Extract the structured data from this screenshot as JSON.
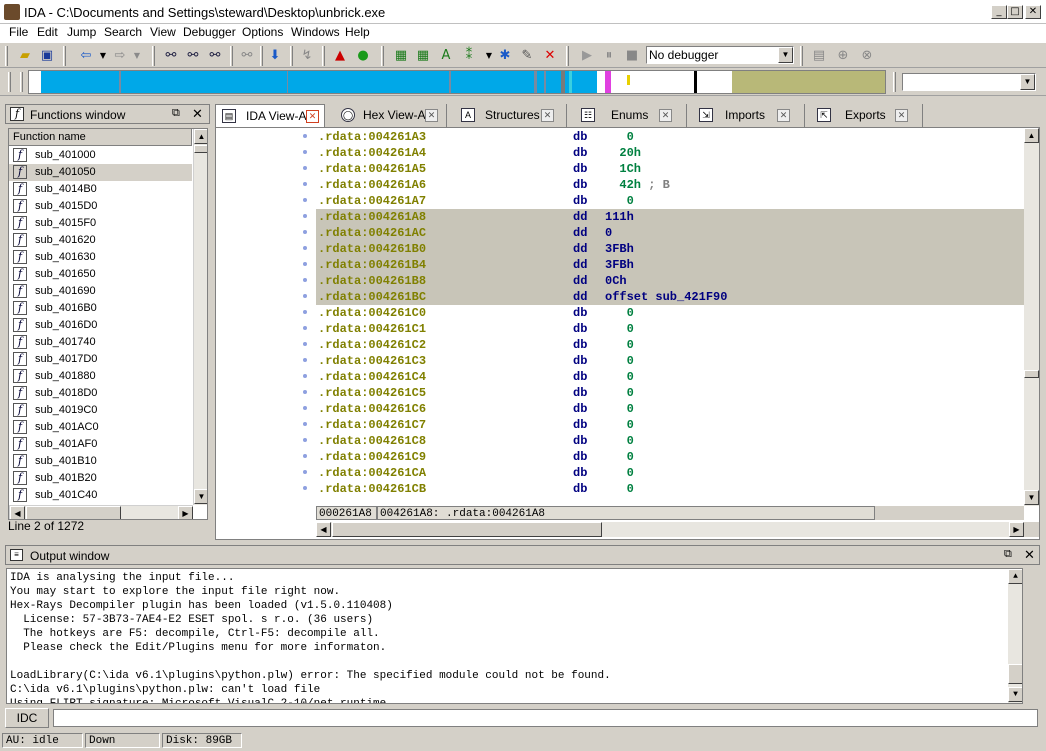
{
  "window": {
    "title": "IDA - C:\\Documents and Settings\\steward\\Desktop\\unbrick.exe"
  },
  "menu": [
    "File",
    "Edit",
    "Jump",
    "Search",
    "View",
    "Debugger",
    "Options",
    "Windows",
    "Help"
  ],
  "toolbar": {
    "debugger_select": "No debugger"
  },
  "functions_window": {
    "title": "Functions window",
    "column_header": "Function name",
    "items": [
      "sub_401000",
      "sub_401050",
      "sub_4014B0",
      "sub_4015D0",
      "sub_4015F0",
      "sub_401620",
      "sub_401630",
      "sub_401650",
      "sub_401690",
      "sub_4016B0",
      "sub_4016D0",
      "sub_401740",
      "sub_4017D0",
      "sub_401880",
      "sub_4018D0",
      "sub_4019C0",
      "sub_401AC0",
      "sub_401AF0",
      "sub_401B10",
      "sub_401B20",
      "sub_401C40"
    ],
    "status": "Line 2 of 1272"
  },
  "tabs": [
    "IDA View-A",
    "Hex View-A",
    "Structures",
    "Enums",
    "Imports",
    "Exports"
  ],
  "disasm": [
    {
      "addr": ".rdata:004261A3",
      "mn": "db",
      "op": "   0",
      "sel": false
    },
    {
      "addr": ".rdata:004261A4",
      "mn": "db",
      "op": "  20h",
      "sel": false
    },
    {
      "addr": ".rdata:004261A5",
      "mn": "db",
      "op": "  1Ch",
      "sel": false
    },
    {
      "addr": ".rdata:004261A6",
      "mn": "db",
      "op": "  42h",
      "cm": " ; B",
      "sel": false
    },
    {
      "addr": ".rdata:004261A7",
      "mn": "db",
      "op": "   0",
      "sel": false
    },
    {
      "addr": ".rdata:004261A8",
      "mn": "dd",
      "op": "111h",
      "sel": true
    },
    {
      "addr": ".rdata:004261AC",
      "mn": "dd",
      "op": "0",
      "sel": true
    },
    {
      "addr": ".rdata:004261B0",
      "mn": "dd",
      "op": "3FBh",
      "sel": true
    },
    {
      "addr": ".rdata:004261B4",
      "mn": "dd",
      "op": "3FBh",
      "sel": true
    },
    {
      "addr": ".rdata:004261B8",
      "mn": "dd",
      "op": "0Ch",
      "sel": true
    },
    {
      "addr": ".rdata:004261BC",
      "mn": "dd",
      "op": "offset sub_421F90",
      "sel": true
    },
    {
      "addr": ".rdata:004261C0",
      "mn": "db",
      "op": "   0",
      "sel": false
    },
    {
      "addr": ".rdata:004261C1",
      "mn": "db",
      "op": "   0",
      "sel": false
    },
    {
      "addr": ".rdata:004261C2",
      "mn": "db",
      "op": "   0",
      "sel": false
    },
    {
      "addr": ".rdata:004261C3",
      "mn": "db",
      "op": "   0",
      "sel": false
    },
    {
      "addr": ".rdata:004261C4",
      "mn": "db",
      "op": "   0",
      "sel": false
    },
    {
      "addr": ".rdata:004261C5",
      "mn": "db",
      "op": "   0",
      "sel": false
    },
    {
      "addr": ".rdata:004261C6",
      "mn": "db",
      "op": "   0",
      "sel": false
    },
    {
      "addr": ".rdata:004261C7",
      "mn": "db",
      "op": "   0",
      "sel": false
    },
    {
      "addr": ".rdata:004261C8",
      "mn": "db",
      "op": "   0",
      "sel": false
    },
    {
      "addr": ".rdata:004261C9",
      "mn": "db",
      "op": "   0",
      "sel": false
    },
    {
      "addr": ".rdata:004261CA",
      "mn": "db",
      "op": "   0",
      "sel": false
    },
    {
      "addr": ".rdata:004261CB",
      "mn": "db",
      "op": "   0",
      "sel": false
    }
  ],
  "view_status": {
    "offset": "000261A8",
    "location": "004261A8: .rdata:004261A8"
  },
  "output_window": {
    "title": "Output window",
    "lines": [
      "IDA is analysing the input file...",
      "You may start to explore the input file right now.",
      "Hex-Rays Decompiler plugin has been loaded (v1.5.0.110408)",
      "  License: 57-3B73-7AE4-E2 ESET spol. s r.o. (36 users)",
      "  The hotkeys are F5: decompile, Ctrl-F5: decompile all.",
      "  Please check the Edit/Plugins menu for more informaton.",
      "",
      "LoadLibrary(C:\\ida v6.1\\plugins\\python.plw) error: The specified module could not be found.",
      "C:\\ida v6.1\\plugins\\python.plw: can't load file",
      "Using FLIRT signature: Microsoft VisualC 2-10/net runtime"
    ]
  },
  "command": {
    "label": "IDC",
    "value": ""
  },
  "status_bar": {
    "au": "AU:  idle",
    "direction": "Down",
    "disk": "Disk: 89GB"
  }
}
